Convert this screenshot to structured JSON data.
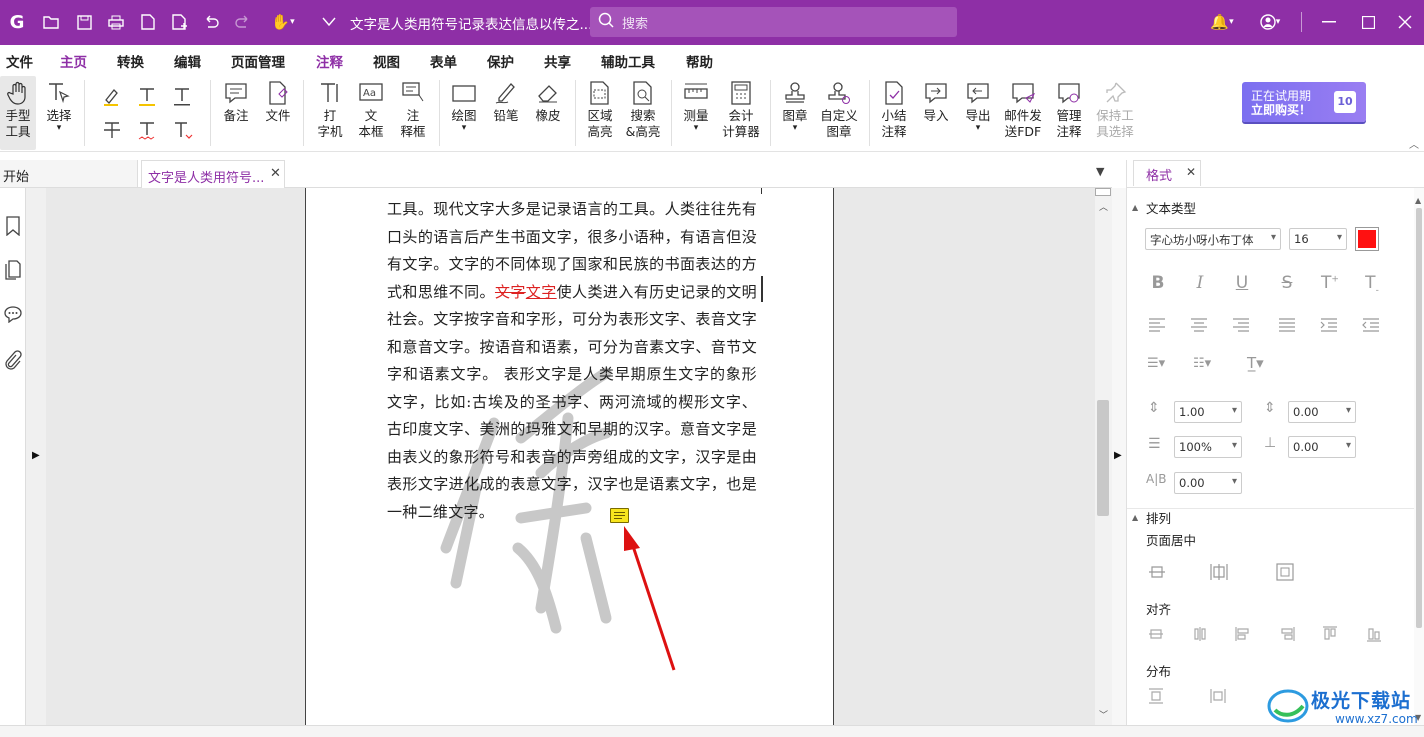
{
  "title": {
    "doc_title": "文字是人类用符号记录表达信息以传之...",
    "search_placeholder": "搜索"
  },
  "menu": [
    "文件",
    "主页",
    "转换",
    "编辑",
    "页面管理",
    "注释",
    "视图",
    "表单",
    "保护",
    "共享",
    "辅助工具",
    "帮助"
  ],
  "ribbon": {
    "hand": "手型\n工具",
    "select": "选择",
    "note": "备注",
    "file": "文件",
    "typewriter": "打\n字机",
    "textbox": "文\n本框",
    "callout": "注\n释框",
    "draw": "绘图",
    "pencil": "铅笔",
    "eraser": "橡皮",
    "area_highlight": "区域\n高亮",
    "search_highlight": "搜索\n&高亮",
    "measure": "测量",
    "calculator": "会计\n计算器",
    "stamp": "图章",
    "custom_stamp": "自定义\n图章",
    "summarize": "小结\n注释",
    "import": "导入",
    "export": "导出",
    "email": "邮件发\n送FDF",
    "manage": "管理\n注释",
    "keep_tool": "保持工\n具选择",
    "trial_line1": "正在试用期",
    "trial_line2": "立即购买！",
    "trial_days": "10"
  },
  "tabs": {
    "start": "开始",
    "doc": "文字是人类用符号..."
  },
  "doc": {
    "before": "工具。现代文字大多是记录语言的工具。人类往往先有口头的语言后产生书面文字，很多小语种，有语言但没有文字。文字的不同体现了国家和民族的书面表达的方式和思维不同。",
    "strike": "文字",
    "insert": "文字",
    "after": "使人类进入有历史记录的文明社会。文字按字音和字形，可分为表形文字、表音文字和意音文字。按语音和语素，可分为音素文字、音节文字和语素文字。 表形文字是人类早期原生文字的象形文字，比如:古埃及的圣书字、两河流域的楔形文字、古印度文字、美洲的玛雅文和早期的汉字。意音文字是由表义的象形符号和表音的声旁组成的文字，汉字是由表形文字进化成的表意文字，汉字也是语素文字，也是一种二维文字。"
  },
  "panel": {
    "tab": "格式",
    "text_type": "文本类型",
    "font": "字心坊小呀小布丁体",
    "size": "16",
    "line_spacing": "1.00",
    "para_spacing": "0.00",
    "scale": "100%",
    "indent": "0.00",
    "char_spacing": "0.00",
    "arrange": "排列",
    "page_center": "页面居中",
    "align": "对齐",
    "distribute": "分布",
    "color": "#ff1111"
  },
  "watermark": {
    "brand": "极光下载站",
    "url": "www.xz7.com"
  },
  "colors": {
    "accent": "#8e2fa6",
    "arrow": "#d11"
  }
}
